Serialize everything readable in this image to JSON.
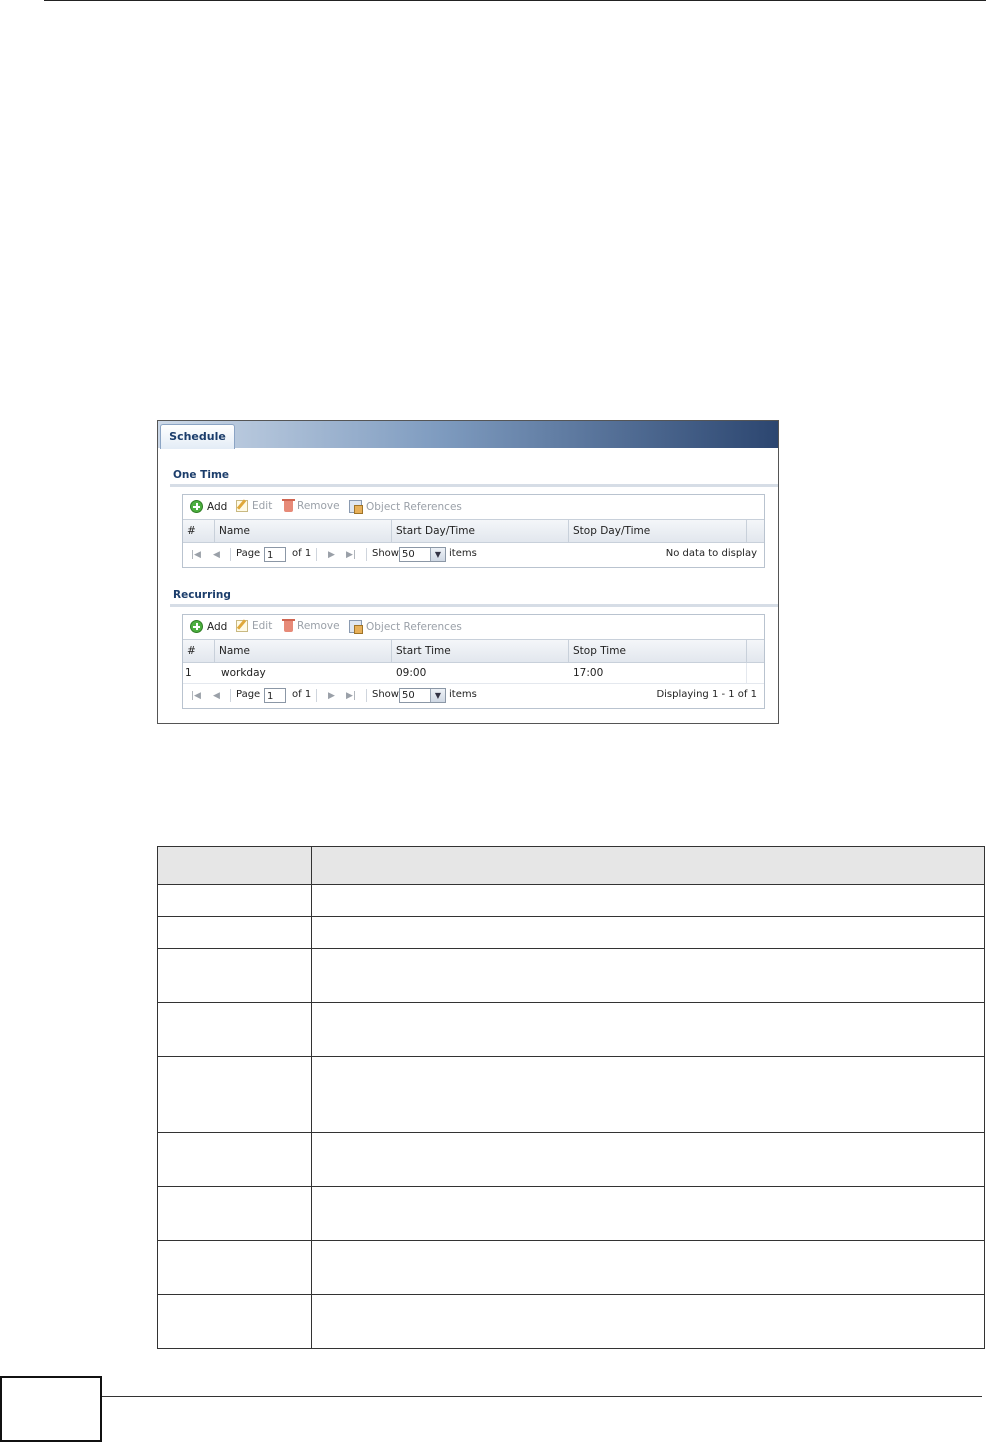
{
  "panel": {
    "tab_label": "Schedule",
    "one_time": {
      "title": "One Time",
      "toolbar": {
        "add": "Add",
        "edit": "Edit",
        "remove": "Remove",
        "references": "Object References"
      },
      "columns": [
        "#",
        "Name",
        "Start Day/Time",
        "Stop Day/Time"
      ],
      "rows": [],
      "pager": {
        "page_label": "Page",
        "page_value": "1",
        "of_label": "of 1",
        "show_label": "Show",
        "show_value": "50",
        "items_label": "items",
        "status": "No data to display"
      }
    },
    "recurring": {
      "title": "Recurring",
      "toolbar": {
        "add": "Add",
        "edit": "Edit",
        "remove": "Remove",
        "references": "Object References"
      },
      "columns": [
        "#",
        "Name",
        "Start Time",
        "Stop Time"
      ],
      "rows": [
        {
          "num": "1",
          "name": "workday",
          "start": "09:00",
          "stop": "17:00"
        }
      ],
      "pager": {
        "page_label": "Page",
        "page_value": "1",
        "of_label": "of 1",
        "show_label": "Show",
        "show_value": "50",
        "items_label": "items",
        "status": "Displaying 1 - 1 of 1"
      }
    }
  }
}
